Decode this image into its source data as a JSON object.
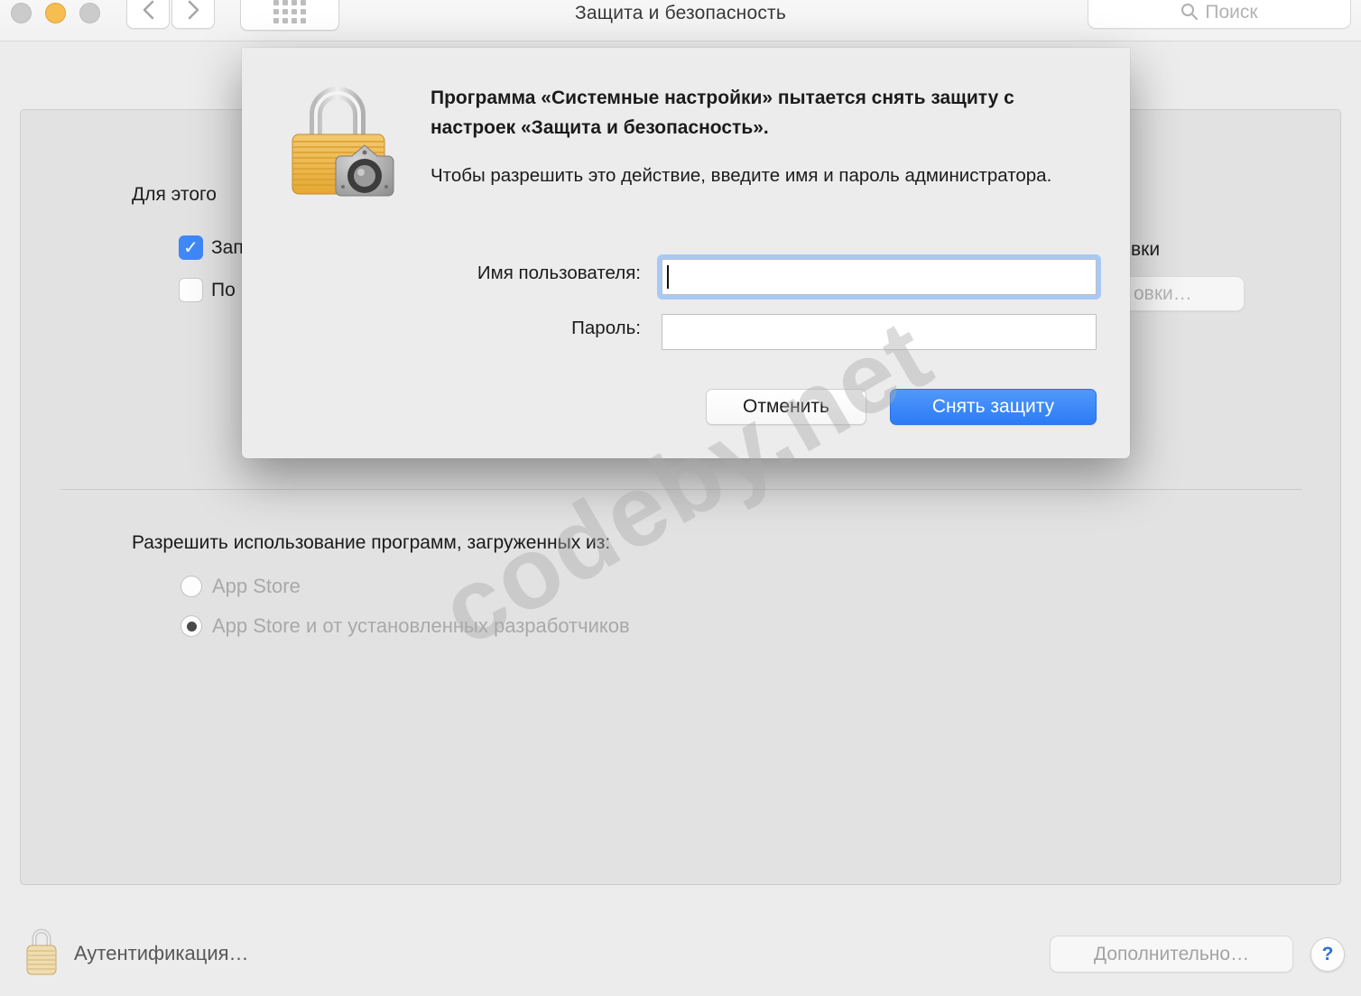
{
  "toolbar": {
    "title": "Защита и безопасность",
    "search_placeholder": "Поиск"
  },
  "dialog": {
    "title": "Программа «Системные настройки» пытается снять защиту с настроек «Защита и безопасность».",
    "message": "Чтобы разрешить это действие, введите имя и пароль администратора.",
    "username_label": "Имя пользователя:",
    "username_value": "",
    "password_label": "Пароль:",
    "password_value": "",
    "cancel_label": "Отменить",
    "confirm_label": "Снять защиту",
    "accent_color": "#3d87f5"
  },
  "content": {
    "heading_fragment": "Для этого",
    "checkbox1": {
      "label_fragment": "Зап",
      "checked": true
    },
    "checkbox2": {
      "label_fragment": "По",
      "checked": false
    },
    "right_text_fragment": "вки",
    "right_button_fragment": "овки…",
    "gatekeeper_heading": "Разрешить использование программ, загруженных из:",
    "radio1": {
      "label": "App Store",
      "selected": false
    },
    "radio2": {
      "label": "App Store и от установленных разработчиков",
      "selected": true
    },
    "checkbox_color": "#3f88f7"
  },
  "footer": {
    "auth_label": "Аутентификация…",
    "advanced_label": "Дополнительно…",
    "help_label": "?"
  },
  "watermark": "codeby.net"
}
